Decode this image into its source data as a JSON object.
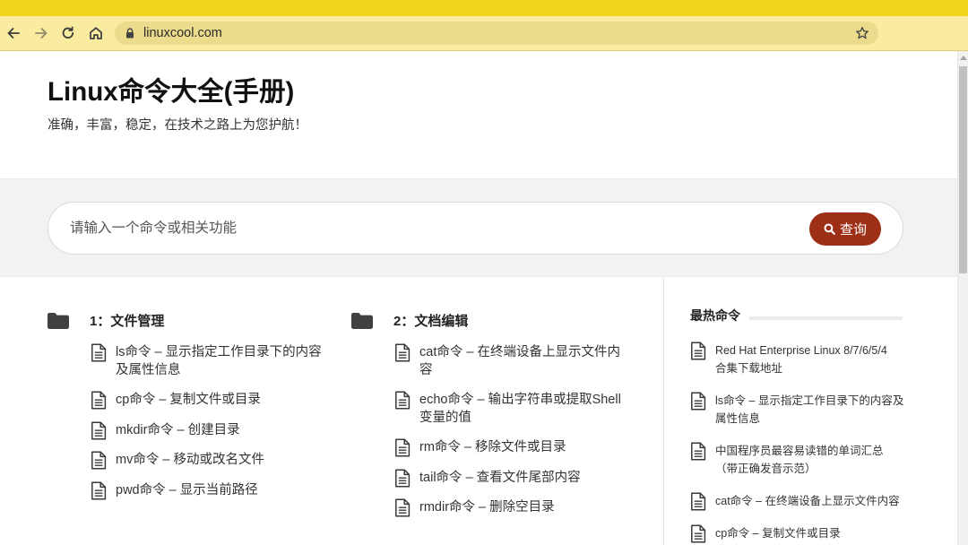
{
  "browser": {
    "url": "linuxcool.com",
    "nav_icons": [
      "back-arrow-icon",
      "forward-arrow-icon",
      "reload-icon",
      "home-icon"
    ],
    "address_icons": [
      "lock-icon",
      "star-icon"
    ]
  },
  "site": {
    "title": "Linux命令大全(手册)",
    "tagline": "准确，丰富，稳定，在技术之路上为您护航！"
  },
  "search": {
    "placeholder": "请输入一个命令或相关功能",
    "button_label": "查询",
    "button_icon": "search-icon"
  },
  "categories": [
    {
      "icon": "folder-icon",
      "heading": "1：文件管理",
      "items": [
        "ls命令 – 显示指定工作目录下的内容及属性信息",
        "cp命令 – 复制文件或目录",
        "mkdir命令 – 创建目录",
        "mv命令 – 移动或改名文件",
        "pwd命令 – 显示当前路径"
      ]
    },
    {
      "icon": "folder-icon",
      "heading": "2：文档编辑",
      "items": [
        "cat命令 – 在终端设备上显示文件内容",
        "echo命令 – 输出字符串或提取Shell变量的值",
        "rm命令 – 移除文件或目录",
        "tail命令 – 查看文件尾部内容",
        "rmdir命令 – 删除空目录"
      ]
    }
  ],
  "sidebar": {
    "heading": "最热命令",
    "item_icon": "document-icon",
    "items": [
      "Red Hat Enterprise Linux 8/7/6/5/4合集下载地址",
      "ls命令 – 显示指定工作目录下的内容及属性信息",
      "中国程序员最容易读错的单词汇总（带正确发音示范）",
      "cat命令 – 在终端设备上显示文件内容",
      "cp命令 – 复制文件或目录"
    ]
  },
  "theme": {
    "tab_strip": "#f3d41c",
    "toolbar": "#f9eba0",
    "omnibox": "#eadb8d",
    "accent": "#9e2f17",
    "band": "#f2f2f2",
    "text": "#333333"
  }
}
